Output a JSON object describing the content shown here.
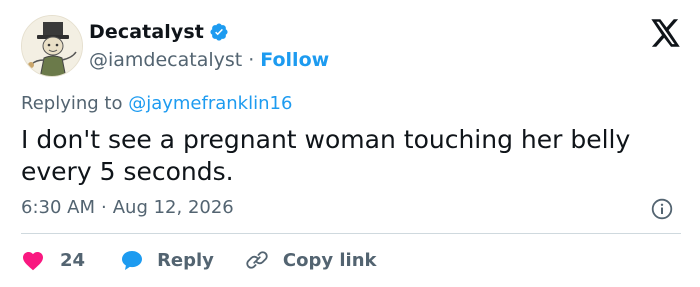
{
  "user": {
    "display_name": "Decatalyst",
    "handle": "@iamdecatalyst",
    "separator": "·",
    "follow_label": "Follow",
    "avatar_icon": "avatar-cartoon-figure-top-hat",
    "verified_icon": "verified-badge-icon"
  },
  "reply": {
    "prefix": "Replying to",
    "mention": "@jaymefranklin16"
  },
  "tweet": {
    "text": "I don't see a pregnant woman touching her belly every 5 seconds.",
    "time": "6:30 AM",
    "separator": "·",
    "date": "Aug 12, 2026"
  },
  "actions": {
    "like_count": "24",
    "reply_label": "Reply",
    "copy_label": "Copy link"
  },
  "icons": {
    "x_logo": "x-logo-icon",
    "info": "info-icon",
    "like": "heart-icon",
    "reply": "speech-bubble-icon",
    "copy": "link-icon"
  },
  "colors": {
    "accent": "#1d9bf0",
    "like": "#f91880",
    "text": "#0f1419",
    "secondary": "#536471",
    "divider": "#cfd9de"
  }
}
